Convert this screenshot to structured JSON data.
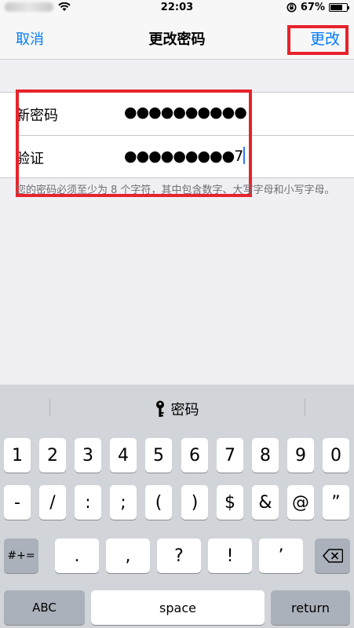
{
  "status_bar": {
    "time": "22:03",
    "battery": "67%",
    "battery_level": 0.67
  },
  "nav": {
    "cancel": "取消",
    "title": "更改密码",
    "change": "更改"
  },
  "form": {
    "new_password_label": "新密码",
    "new_password_value": "●●●●●●●●●●",
    "verify_label": "验证",
    "verify_value": "●●●●●●●●●7"
  },
  "hint": "您的密码必须至少为 8 个字符，其中包含数字、大写字母和小写字母。",
  "keyboard": {
    "suggestion": "密码",
    "row1": [
      "1",
      "2",
      "3",
      "4",
      "5",
      "6",
      "7",
      "8",
      "9",
      "0"
    ],
    "row2": [
      "-",
      "/",
      ":",
      ";",
      "(",
      ")",
      "$",
      "&",
      "@",
      "”"
    ],
    "row3": [
      "#+=",
      ".",
      ",",
      "?",
      "!",
      "’"
    ],
    "row4": [
      "ABC",
      "space",
      "return"
    ]
  },
  "colors": {
    "accent": "#007aff",
    "highlight": "#e8232a"
  }
}
